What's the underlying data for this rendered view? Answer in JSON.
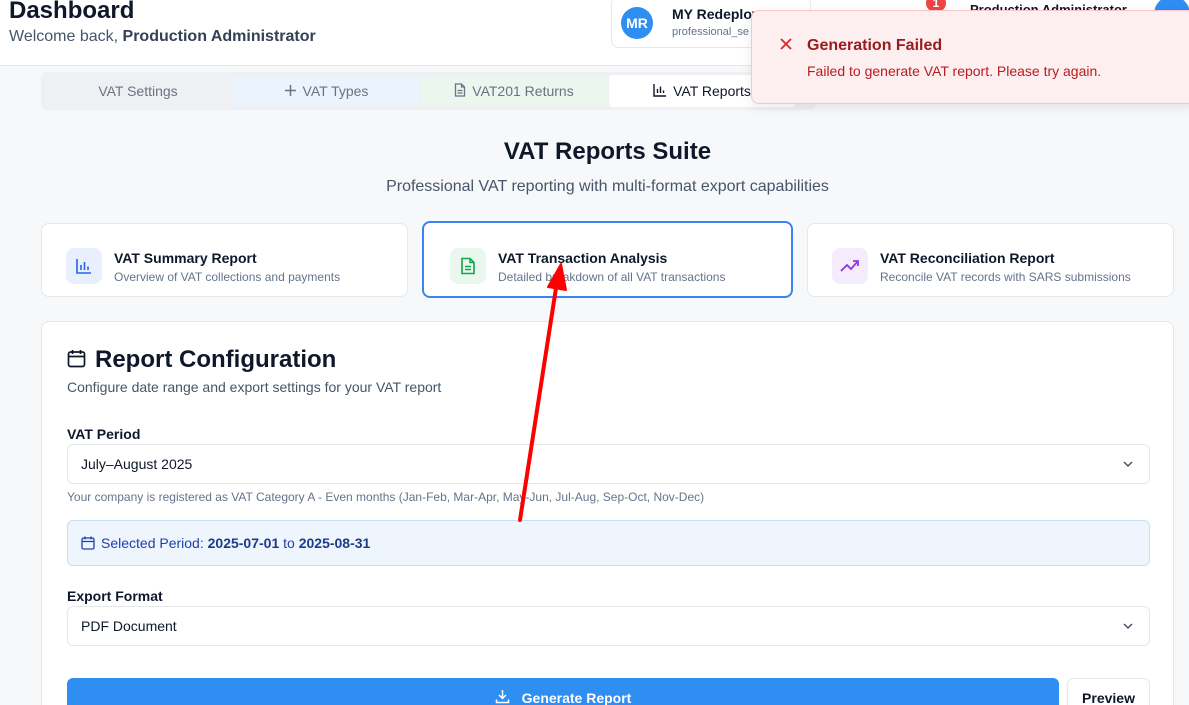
{
  "header": {
    "title": "Dashboard",
    "welcome_prefix": "Welcome back, ",
    "welcome_user": "Production Administrator",
    "company": {
      "initials": "MR",
      "name": "MY Redeploy",
      "sub": "professional_se"
    },
    "notification_count": "1",
    "user_label": "Production Administrator"
  },
  "tabs": [
    {
      "label": "VAT Settings",
      "icon": "none"
    },
    {
      "label": "VAT Types",
      "icon": "plus-icon"
    },
    {
      "label": "VAT201 Returns",
      "icon": "document-icon"
    },
    {
      "label": "VAT Reports",
      "icon": "bar-chart-icon"
    }
  ],
  "suite": {
    "title": "VAT Reports Suite",
    "subtitle": "Professional VAT reporting with multi-format export capabilities"
  },
  "report_types": [
    {
      "name": "VAT Summary Report",
      "desc": "Overview of VAT collections and payments",
      "icon": "bar-chart-icon",
      "color": "#2563eb"
    },
    {
      "name": "VAT Transaction Analysis",
      "desc": "Detailed breakdown of all VAT transactions",
      "icon": "file-text-icon",
      "color": "#16a34a"
    },
    {
      "name": "VAT Reconciliation Report",
      "desc": "Reconcile VAT records with SARS submissions",
      "icon": "trending-up-icon",
      "color": "#9333ea"
    }
  ],
  "config": {
    "title": "Report Configuration",
    "subtitle": "Configure date range and export settings for your VAT report",
    "period_label": "VAT Period",
    "period_value": "July–August 2025",
    "period_hint": "Your company is registered as VAT Category A - Even months (Jan-Feb, Mar-Apr, May-Jun, Jul-Aug, Sep-Oct, Nov-Dec)",
    "selected_prefix": "Selected Period: ",
    "selected_from": "2025-07-01",
    "selected_to_word": " to ",
    "selected_to": "2025-08-31",
    "export_label": "Export Format",
    "export_value": "PDF Document",
    "generate_label": "Generate Report",
    "preview_label": "Preview"
  },
  "toast": {
    "title": "Generation Failed",
    "message": "Failed to generate VAT report. Please try again."
  },
  "colors": {
    "primary": "#2f8ef2",
    "error": "#ef4444",
    "annotation_arrow": "#ff0000"
  }
}
